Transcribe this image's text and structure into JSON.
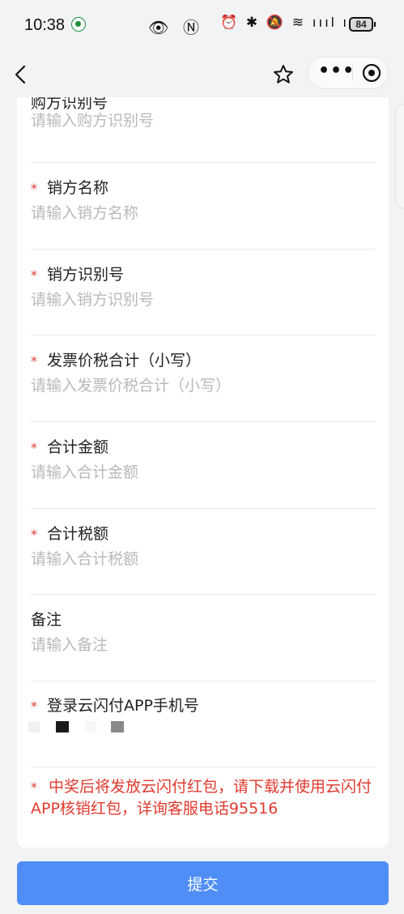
{
  "status_bar": {
    "time": "10:38",
    "battery": "84"
  },
  "form": {
    "fields": [
      {
        "label": "购方识别号",
        "placeholder": "请输入购方识别号",
        "required": false
      },
      {
        "label": "销方名称",
        "placeholder": "请输入销方名称",
        "required": true
      },
      {
        "label": "销方识别号",
        "placeholder": "请输入销方识别号",
        "required": true
      },
      {
        "label": "发票价税合计（小写）",
        "placeholder": "请输入发票价税合计（小写）",
        "required": true
      },
      {
        "label": "合计金额",
        "placeholder": "请输入合计金额",
        "required": true
      },
      {
        "label": "合计税额",
        "placeholder": "请输入合计税额",
        "required": true
      },
      {
        "label": "备注",
        "placeholder": "请输入备注",
        "required": false
      },
      {
        "label": "登录云闪付APP手机号",
        "placeholder": "",
        "required": true
      }
    ],
    "required_mark": "*",
    "notice": "中奖后将发放云闪付红包，请下载并使用云闪付APP核销红包，详询客服电话95516"
  },
  "submit_label": "提交",
  "colors": {
    "required": "#e03a2f",
    "primary_button": "#4f8ef7",
    "placeholder": "#b9b9b9"
  }
}
